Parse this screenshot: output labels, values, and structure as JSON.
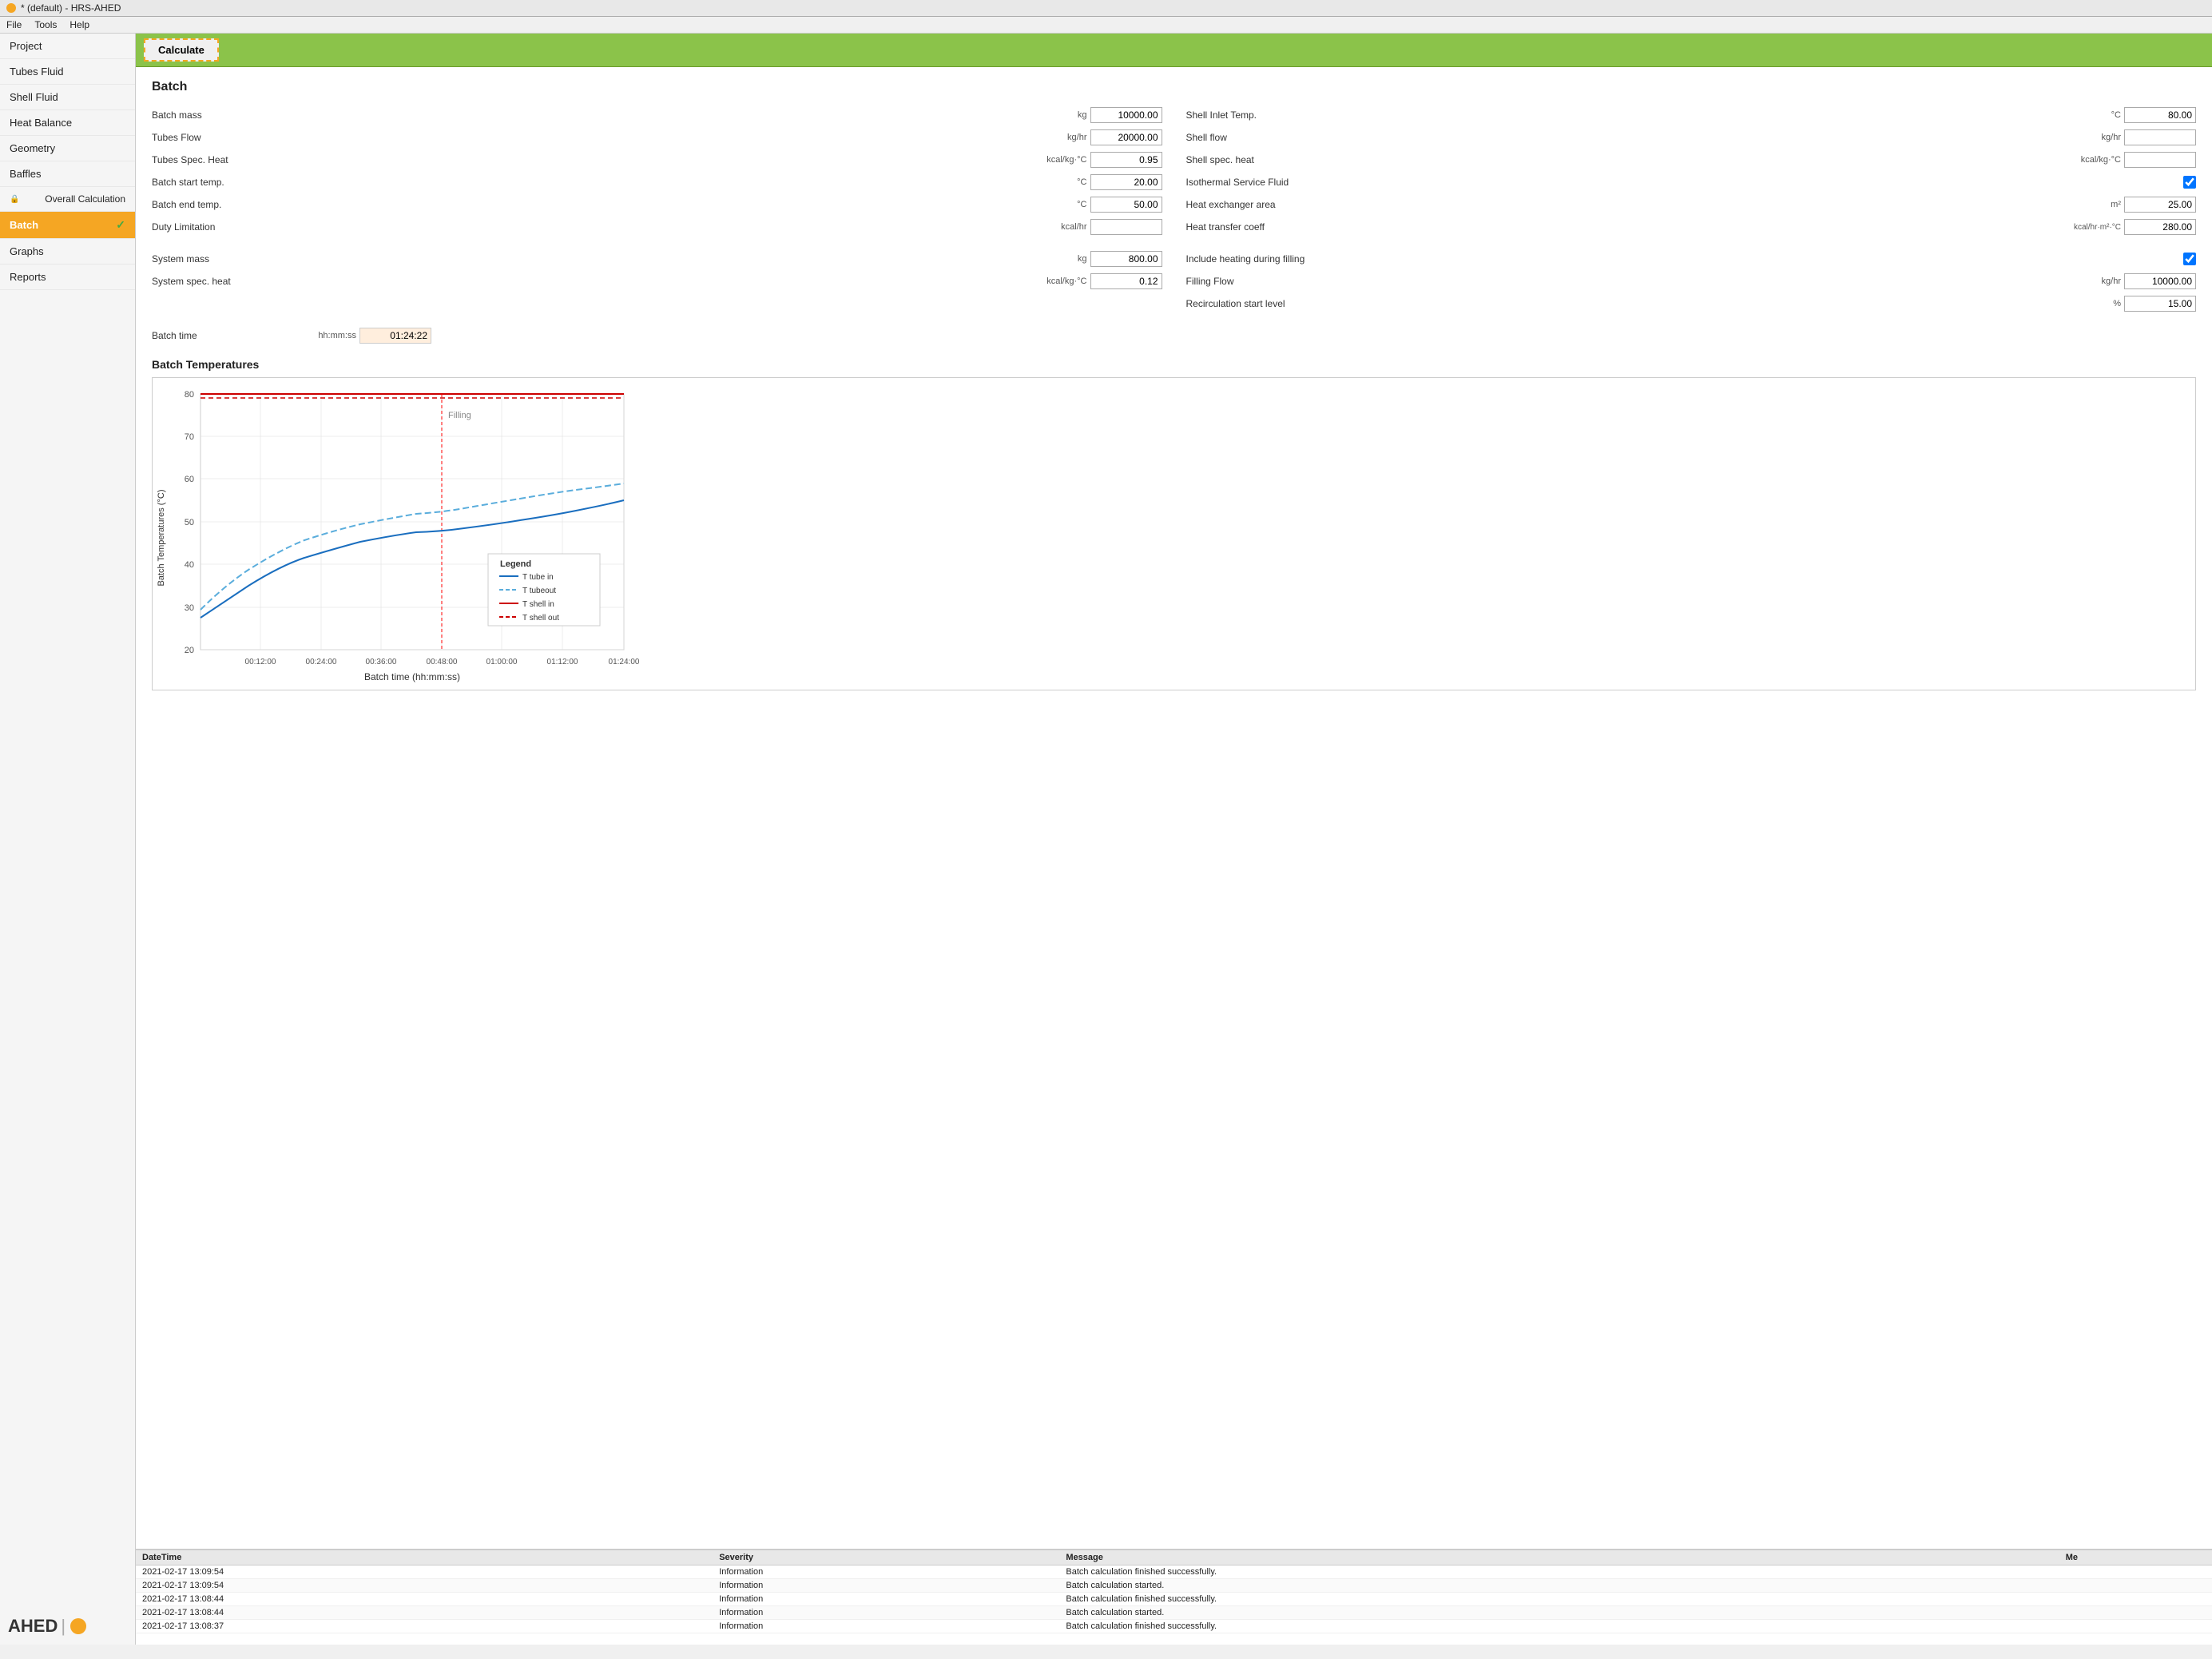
{
  "titleBar": {
    "dot": "orange",
    "title": "* (default) - HRS-AHED"
  },
  "menuBar": {
    "items": [
      "File",
      "Tools",
      "Help"
    ]
  },
  "sidebar": {
    "items": [
      {
        "id": "project",
        "label": "Project",
        "active": false,
        "locked": false
      },
      {
        "id": "tubes-fluid",
        "label": "Tubes Fluid",
        "active": false,
        "locked": false
      },
      {
        "id": "shell-fluid",
        "label": "Shell Fluid",
        "active": false,
        "locked": false
      },
      {
        "id": "heat-balance",
        "label": "Heat Balance",
        "active": false,
        "locked": false
      },
      {
        "id": "geometry",
        "label": "Geometry",
        "active": false,
        "locked": false
      },
      {
        "id": "baffles",
        "label": "Baffles",
        "active": false,
        "locked": false
      },
      {
        "id": "overall-calc",
        "label": "Overall Calculation",
        "active": false,
        "locked": true
      },
      {
        "id": "batch",
        "label": "Batch",
        "active": true,
        "locked": false,
        "checkmark": true
      },
      {
        "id": "graphs",
        "label": "Graphs",
        "active": false,
        "locked": false
      },
      {
        "id": "reports",
        "label": "Reports",
        "active": false,
        "locked": false
      }
    ],
    "logo": {
      "text": "AHED",
      "separator": "|"
    }
  },
  "toolbar": {
    "calculate_label": "Calculate"
  },
  "batchForm": {
    "title": "Batch",
    "leftFields": [
      {
        "label": "Batch mass",
        "unit": "kg",
        "value": "10000.00",
        "readonly": false
      },
      {
        "label": "Tubes Flow",
        "unit": "kg/hr",
        "value": "20000.00",
        "readonly": false
      },
      {
        "label": "Tubes Spec. Heat",
        "unit": "kcal/kg·°C",
        "value": "0.95",
        "readonly": false
      },
      {
        "label": "Batch start temp.",
        "unit": "°C",
        "value": "20.00",
        "readonly": false
      },
      {
        "label": "Batch end temp.",
        "unit": "°C",
        "value": "50.00",
        "readonly": false
      },
      {
        "label": "Duty Limitation",
        "unit": "kcal/hr",
        "value": "",
        "readonly": false
      }
    ],
    "rightFields": [
      {
        "label": "Shell Inlet Temp.",
        "unit": "°C",
        "value": "80.00",
        "readonly": false
      },
      {
        "label": "Shell flow",
        "unit": "kg/hr",
        "value": "",
        "readonly": false
      },
      {
        "label": "Shell spec. heat",
        "unit": "kcal/kg·°C",
        "value": "",
        "readonly": false
      },
      {
        "label": "Isothermal Service Fluid",
        "unit": "",
        "value": "",
        "checkbox": true,
        "checked": true
      },
      {
        "label": "Heat exchanger area",
        "unit": "m²",
        "value": "25.00",
        "readonly": false
      },
      {
        "label": "Heat transfer coeff",
        "unit": "kcal/hr·m²·°C",
        "value": "280.00",
        "readonly": false
      }
    ],
    "systemFields": [
      {
        "label": "System mass",
        "unit": "kg",
        "value": "800.00",
        "readonly": false
      },
      {
        "label": "System spec. heat",
        "unit": "kcal/kg·°C",
        "value": "0.12",
        "readonly": false
      }
    ],
    "fillingFields": [
      {
        "label": "Include heating during filling",
        "unit": "",
        "value": "",
        "checkbox": true,
        "checked": true
      },
      {
        "label": "Filling Flow",
        "unit": "kg/hr",
        "value": "10000.00",
        "readonly": false
      },
      {
        "label": "Recirculation start level",
        "unit": "%",
        "value": "15.00",
        "readonly": false
      }
    ],
    "batchTime": {
      "label": "Batch time",
      "unit": "hh:mm:ss",
      "value": "01:24:22"
    }
  },
  "chart": {
    "title": "Batch Temperatures",
    "xLabel": "Batch time (hh:mm:ss)",
    "yLabel": "Batch Temperatures (°C)",
    "yMin": 20,
    "yMax": 80,
    "xTicks": [
      "00:12:00",
      "00:24:00",
      "00:36:00",
      "00:48:00",
      "01:00:00",
      "01:12:00",
      "01:24:00"
    ],
    "fillingLabel": "Filling",
    "legend": {
      "items": [
        {
          "label": "T tube in",
          "color": "#1a6ebf",
          "dash": false
        },
        {
          "label": "T tubeout",
          "color": "#5aaddc",
          "dash": true
        },
        {
          "label": "T shell in",
          "color": "#cc0000",
          "dash": false
        },
        {
          "label": "T shell out",
          "color": "#cc0000",
          "dash": true
        }
      ]
    }
  },
  "logPanel": {
    "columns": [
      "DateTime",
      "Severity",
      "Message",
      "Me"
    ],
    "rows": [
      {
        "datetime": "2021-02-17 13:09:54",
        "severity": "Information",
        "message": "Batch calculation finished successfully."
      },
      {
        "datetime": "2021-02-17 13:09:54",
        "severity": "Information",
        "message": "Batch calculation started."
      },
      {
        "datetime": "2021-02-17 13:08:44",
        "severity": "Information",
        "message": "Batch calculation finished successfully."
      },
      {
        "datetime": "2021-02-17 13:08:44",
        "severity": "Information",
        "message": "Batch calculation started."
      },
      {
        "datetime": "2021-02-17 13:08:37",
        "severity": "Information",
        "message": "Batch calculation finished successfully."
      }
    ]
  }
}
